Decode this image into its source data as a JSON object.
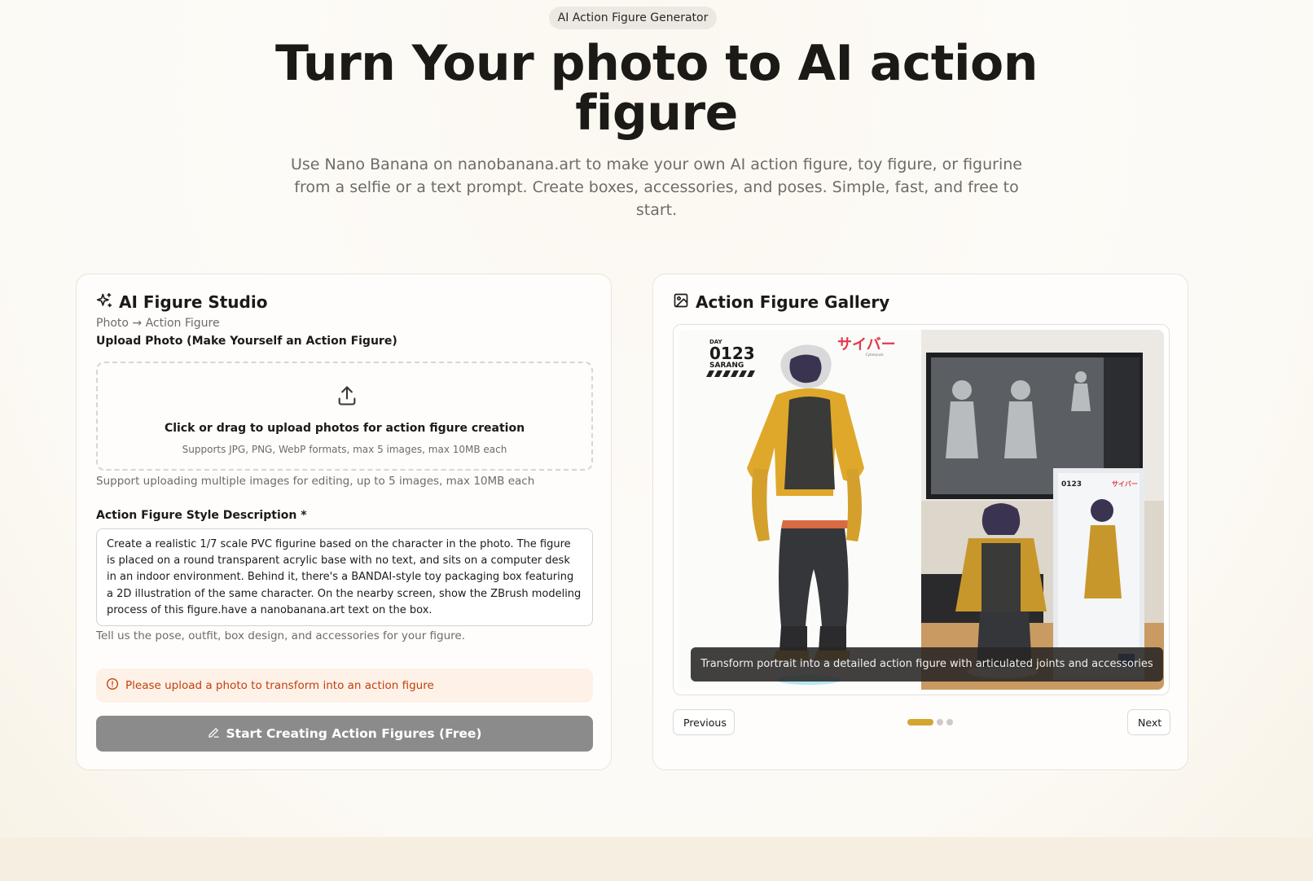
{
  "hero": {
    "badge": "AI Action Figure Generator",
    "title": "Turn Your photo to AI action figure",
    "subtitle": "Use Nano Banana on nanobanana.art to make your own AI action figure, toy figure, or figurine from a selfie or a text prompt. Create boxes, accessories, and poses. Simple, fast, and free to start."
  },
  "studio": {
    "title": "AI Figure Studio",
    "subtitle": "Photo → Action Figure",
    "upload_label": "Upload Photo (Make Yourself an Action Figure)",
    "upload_title": "Click or drag to upload photos for action figure creation",
    "upload_formats": "Supports JPG, PNG, WebP formats, max 5 images, max 10MB each",
    "upload_hint": "Support uploading multiple images for editing, up to 5 images, max 10MB each",
    "prompt_label": "Action Figure Style Description *",
    "prompt_value": "Create a realistic 1/7 scale PVC figurine based on the character in the photo. The figure is placed on a round transparent acrylic base with no text, and sits on a computer desk in an indoor environment. Behind it, there's a BANDAI-style toy packaging box featuring a 2D illustration of the same character. On the nearby screen, show the ZBrush modeling process of this figure.have a nanobanana.art text on the box.",
    "prompt_hint": "Tell us the pose, outfit, box design, and accessories for your figure.",
    "alert": "Please upload a photo to transform into an action figure",
    "submit": "Start Creating Action Figures (Free)",
    "icon_title": "sparkles-icon",
    "icon_upload": "upload-icon",
    "icon_alert": "alert-circle-icon",
    "icon_submit": "pencil-icon"
  },
  "gallery": {
    "title": "Action Figure Gallery",
    "icon_title": "image-icon",
    "caption": "Transform portrait into a detailed action figure with articulated joints and accessories",
    "image_text": {
      "code_small": "DAY",
      "code": "0123",
      "name": "SARANG",
      "katakana": "サイバー",
      "katakana_sub": "Cyberpunk"
    },
    "prev": "Previous",
    "next": "Next",
    "slide_count": 3,
    "active_slide": 1
  },
  "colors": {
    "accent": "#d4a533",
    "alert_text": "#c2410c",
    "alert_bg": "#fdf1e8",
    "button_disabled": "#8b8b8b"
  }
}
